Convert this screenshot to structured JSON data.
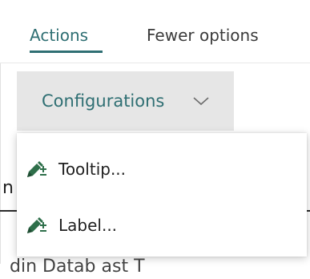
{
  "tabs": [
    {
      "label": "Actions",
      "active": true
    },
    {
      "label": "Fewer options",
      "active": false
    }
  ],
  "config_button": {
    "label": "Configurations",
    "icon": "chevron-down-icon"
  },
  "dropdown": {
    "items": [
      {
        "label": "Tooltip...",
        "icon": "edit-add-icon"
      },
      {
        "label": "Label...",
        "icon": "edit-add-icon"
      }
    ]
  },
  "background": {
    "partial_left_text": "n",
    "partial_bottom_text": "din  Datab  ast T"
  },
  "colors": {
    "accent": "#2f6f73",
    "button_bg": "#e6e6e6",
    "icon": "#2e6f4a"
  }
}
